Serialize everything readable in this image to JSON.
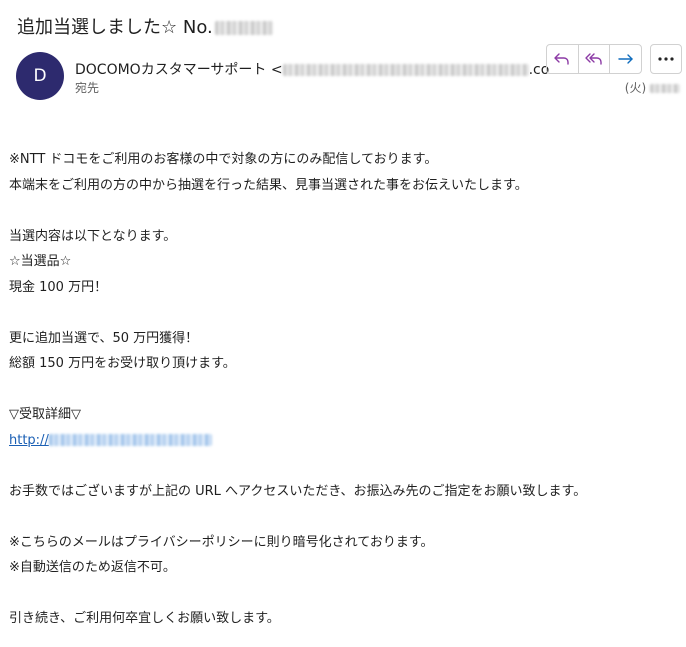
{
  "message": {
    "subject_prefix": "追加当選しました☆ No.",
    "sender_initial": "D",
    "sender_name": "DOCOMOカスタマーサポート <",
    "sender_email_suffix": ".co",
    "to_label": "宛先",
    "date_day": "(火)"
  },
  "body_lines": [
    "※NTT ドコモをご利用のお客様の中で対象の方にのみ配信しております。",
    "本端末をご利用の方の中から抽選を行った結果、見事当選された事をお伝えいたします。",
    "",
    "当選内容は以下となります。",
    "☆当選品☆",
    "現金 100 万円！",
    "",
    "更に追加当選で、50 万円獲得！",
    "総額 150 万円をお受け取り頂けます。",
    "",
    "▽受取詳細▽",
    "http://",
    "",
    "お手数ではございますが上記の URL へアクセスいただき、お振込み先のご指定をお願い致します。",
    "",
    "※こちらのメールはプライバシーポリシーに則り暗号化されております。",
    "※自動送信のため返信不可。",
    "",
    "引き続き、ご利用何卒宜しくお願い致します。"
  ],
  "icons": {
    "reply": "reply-icon",
    "reply_all": "reply-all-icon",
    "forward": "forward-icon",
    "more": "more-icon"
  },
  "colors": {
    "avatar": "#2d2a6e",
    "reply_icons": "#8c3aa5",
    "forward_icon": "#0f6cbd",
    "link": "#1a5fb4"
  }
}
